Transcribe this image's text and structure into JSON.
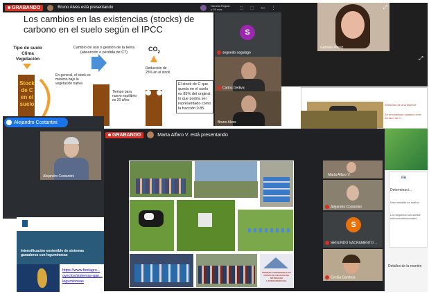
{
  "top_window": {
    "rec_label": "GRABANDO",
    "presenter_text": "Bruno Alves está presentando",
    "participant_hint": "Daniela Rogido\ny 26 más"
  },
  "slide1": {
    "title": "Los cambios en las existencias (stocks) de carbono en el suelo según el IPCC",
    "label_tipo": "Tipo de suelo\nClima\nVegetación",
    "label_cambio": "Cambio de uso o gestión de la tierra (absorción o pérdida de C?)",
    "label_co2": "CO",
    "label_co2_sub": "2",
    "bar_text": "Stock\nde C\nen el\nsuelo",
    "note_general": "En general, el stock es máximo bajo la vegetación nativa",
    "note_reduction": "Reducción de 25% en el stock",
    "note_time": "Tiempo para nuevo equilibrio es 20 años",
    "note_box": "El stock de C que queda en el suelo es 85% del original, lo que podría ser representado como la fracción 0.85."
  },
  "tiles_top": [
    {
      "initial": "S",
      "name": "segundo cegulago",
      "color": "#9c27b0"
    },
    {
      "name": "Carlos Dedivic"
    },
    {
      "name": "Bruno Alves"
    },
    {
      "name": "Gabriela Pérez"
    }
  ],
  "mid_window": {
    "name_pill": "Alejandro Costantini",
    "tile_name": "Alejandro Costantini"
  },
  "right_slide": {
    "text1": "Selección de una especie",
    "text2": "Se encontraron cambios en el número de C..."
  },
  "front_window": {
    "rec_label": "GRABANDO",
    "presenter_text": "Marta Alfaro V. está presentando"
  },
  "collage": {
    "poster_text": "PRIMERA CONFERENCIA DE GRUPO DE GESTION DEL NITROGENO LATINOAMERICANA"
  },
  "participants": [
    {
      "name": "Marta Alfaro V."
    },
    {
      "name": "Alejandro Costantini"
    },
    {
      "initial": "S",
      "name": "SEGUNDO SACRAMENTO ...",
      "color": "#e8710a"
    },
    {
      "name": "Cecilia Gamboa"
    }
  ],
  "details_label": "Detalles de la reunión",
  "side_doc": {
    "heading": "Determinaci...",
    "line1": "Valor medido en suelos",
    "line2": "Los seguidos son similar sobrecorrelacionados..."
  },
  "web": {
    "header": "Intensificación sostenible de sistemas ganaderos con leguminosas",
    "url1": "https://www.fontagro...",
    "url2": "oyectos/sistemas-gan...",
    "url3": "leguminosas"
  },
  "colors": {
    "rec_red": "#d93025",
    "meet_blue": "#1a73e8",
    "bar_brown": "#8b4a12",
    "arrow_orange": "#f0a030",
    "arrow_blue": "#4a8fd8"
  }
}
